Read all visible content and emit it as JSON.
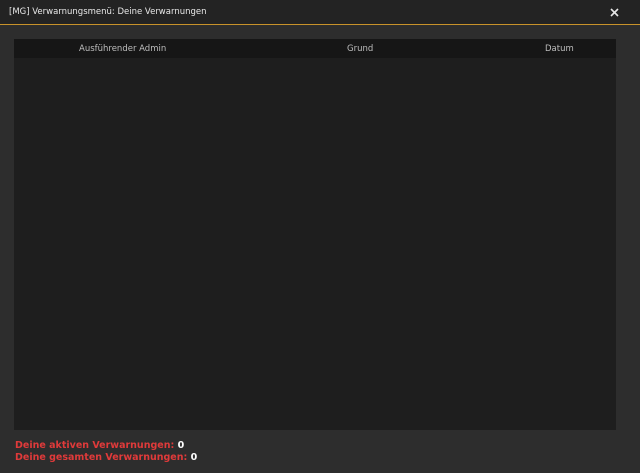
{
  "window": {
    "title": "[MG] Verwarnungsmenü: Deine Verwarnungen",
    "accent_color": "#c8922a",
    "close_icon": "close-icon"
  },
  "table": {
    "columns": [
      "Ausführender Admin",
      "Grund",
      "Datum"
    ],
    "rows": []
  },
  "stats": {
    "active_label": "Deine aktiven Verwarnungen:",
    "active_value": "0",
    "total_label": "Deine gesamten Verwarnungen:",
    "total_value": "0",
    "label_color": "#e03a3a"
  }
}
